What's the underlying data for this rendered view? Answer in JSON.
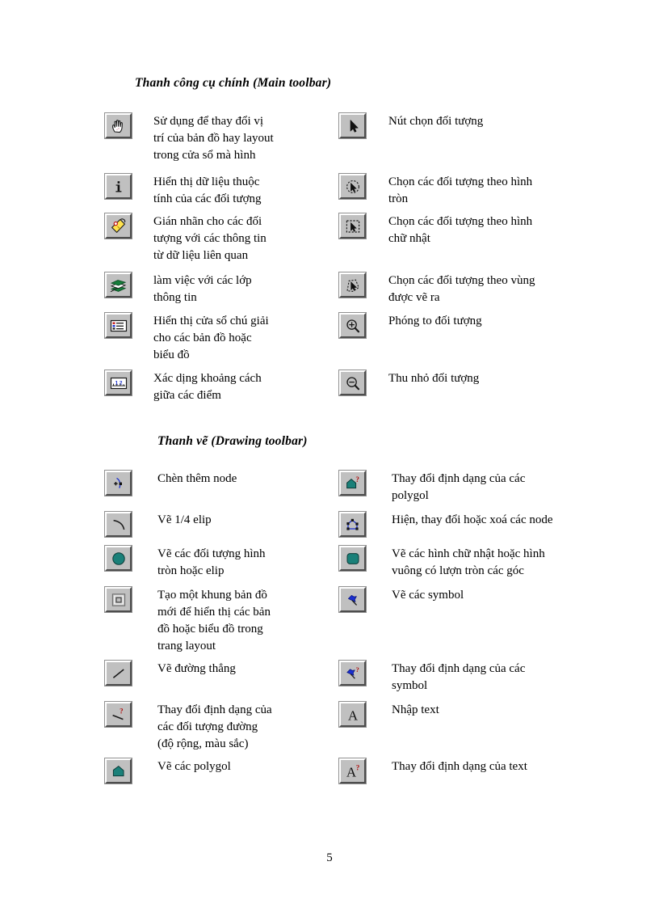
{
  "page": {
    "number": "5"
  },
  "sections": [
    {
      "id": "main-toolbar",
      "heading": "Thanh công cụ chính (Main toolbar)",
      "left_column": [
        {
          "icon": "pan-hand-icon",
          "lines": [
            "Sử dụng để thay đổi vị",
            "trí của bản đồ hay layout",
            "trong cửa sổ mà hình"
          ]
        },
        {
          "icon": "identify-info-icon",
          "lines": [
            "Hiển thị dữ liệu thuộc",
            "tính của các đối tượng"
          ]
        },
        {
          "icon": "label-tag-icon",
          "lines": [
            "Gián nhãn cho các đối",
            "tượng với các thông tin",
            "từ dữ liệu liên quan"
          ]
        },
        {
          "icon": "layer-control-icon",
          "lines": [
            "làm việc với các lớp",
            "thông tin"
          ]
        },
        {
          "icon": "legend-window-icon",
          "lines": [
            "Hiển thị cửa sổ chú giải",
            "cho các bản đồ hoặc",
            "biểu đồ"
          ]
        },
        {
          "icon": "ruler-measure-icon",
          "lines": [
            "Xác dịng khoảng cách",
            "giữa các điểm"
          ]
        }
      ],
      "right_column": [
        {
          "icon": "arrow-select-icon",
          "lines": [
            "Nút chọn đối tượng"
          ]
        },
        {
          "icon": "circle-select-icon",
          "lines": [
            "Chọn các đối tượng theo hình",
            "tròn"
          ]
        },
        {
          "icon": "rectangle-select-icon",
          "lines": [
            "Chọn các đối tượng theo hình",
            "chữ nhật"
          ]
        },
        {
          "icon": "polygon-select-icon",
          "lines": [
            "Chọn các đối tượng theo vùng",
            "được vẽ ra"
          ]
        },
        {
          "icon": "zoom-in-icon",
          "lines": [
            "Phóng to đối tượng"
          ]
        },
        {
          "icon": "zoom-out-icon",
          "lines": [
            "Thu nhỏ đối tượng"
          ]
        }
      ]
    },
    {
      "id": "drawing-toolbar",
      "heading": "Thanh vẽ (Drawing toolbar)",
      "left_column": [
        {
          "icon": "add-node-icon",
          "lines": [
            "Chèn thêm node"
          ]
        },
        {
          "icon": "quarter-ellipse-icon",
          "lines": [
            "Vẽ 1/4 elip"
          ]
        },
        {
          "icon": "ellipse-icon",
          "lines": [
            "Vẽ các đối tượng hình",
            "tròn hoặc elip"
          ]
        },
        {
          "icon": "map-frame-icon",
          "lines": [
            "Tạo một khung bản đồ",
            "mới để hiển thị các bản",
            "đồ hoặc biểu đồ trong",
            "trang layout"
          ]
        },
        {
          "icon": "line-icon",
          "lines": [
            "Vẽ đường thẳng"
          ]
        },
        {
          "icon": "line-style-icon",
          "lines": [
            "Thay đổi định dạng của",
            "các đối tượng đường",
            "(độ rộng, màu sắc)"
          ]
        },
        {
          "icon": "polygon-icon",
          "lines": [
            "Vẽ các polygol"
          ]
        }
      ],
      "right_column": [
        {
          "icon": "polygon-style-icon",
          "lines": [
            "Thay đổi định dạng của các",
            "polygol"
          ]
        },
        {
          "icon": "edit-node-icon",
          "lines": [
            "Hiện, thay đổi hoặc xoá các node"
          ]
        },
        {
          "icon": "rounded-rect-icon",
          "lines": [
            "Vẽ các hình chữ nhật hoặc hình",
            "vuông có lượn tròn các góc"
          ]
        },
        {
          "icon": "symbol-icon",
          "lines": [
            "Vẽ các symbol"
          ]
        },
        {
          "icon": "symbol-style-icon",
          "lines": [
            "Thay đổi định dạng của các",
            "symbol"
          ]
        },
        {
          "icon": "text-tool-icon",
          "lines": [
            "Nhập text"
          ]
        },
        {
          "icon": "text-style-icon",
          "lines": [
            "Thay đổi định dạng của text"
          ]
        }
      ]
    }
  ],
  "colors": {
    "button_face": "#c0c0c0",
    "button_highlight": "#ffffff",
    "button_shadow": "#4d4d4d",
    "teal_fill": "#1a8079",
    "yellow_tag": "#ffe24d",
    "green_layer": "#157d3a",
    "blue_accent": "#1a2fd0",
    "red_accent": "#cc1414",
    "text": "#000000"
  }
}
